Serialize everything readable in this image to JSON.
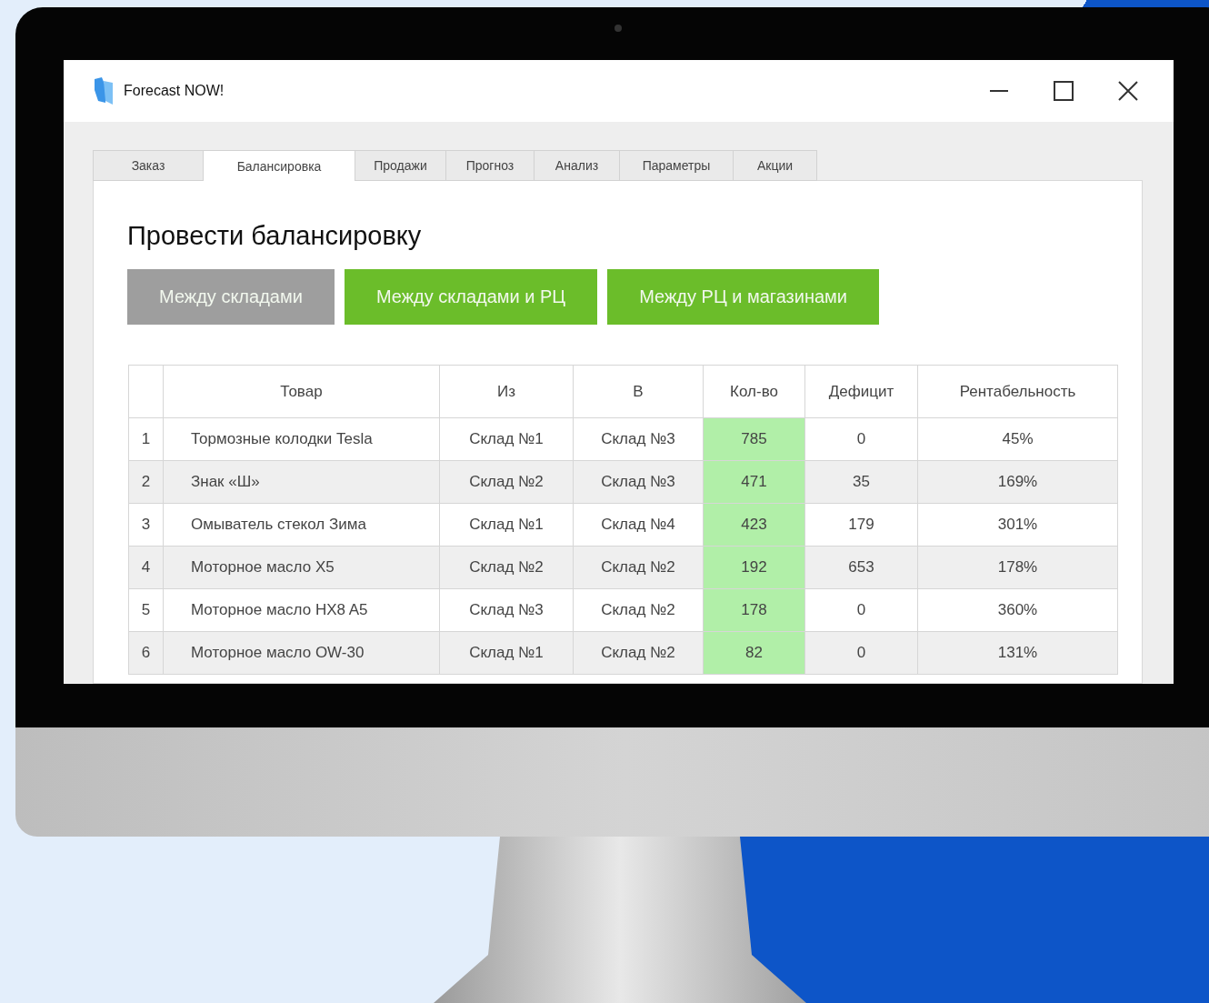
{
  "window": {
    "title": "Forecast NOW!"
  },
  "tabs": [
    {
      "label": "Заказ",
      "selected": false
    },
    {
      "label": "Балансировка",
      "selected": true
    },
    {
      "label": "Продажи",
      "selected": false
    },
    {
      "label": "Прогноз",
      "selected": false
    },
    {
      "label": "Анализ",
      "selected": false
    },
    {
      "label": "Параметры",
      "selected": false
    },
    {
      "label": "Акции",
      "selected": false
    }
  ],
  "heading": "Провести балансировку",
  "modes": [
    {
      "label": "Между складами",
      "selected": true
    },
    {
      "label": "Между складами и РЦ",
      "selected": false
    },
    {
      "label": "Между РЦ и магазинами",
      "selected": false
    }
  ],
  "table": {
    "columns": [
      {
        "label": "Товар",
        "highlighted": false
      },
      {
        "label": "Из",
        "highlighted": false
      },
      {
        "label": "В",
        "highlighted": false
      },
      {
        "label": "Кол-во",
        "highlighted": true
      },
      {
        "label": "Дефицит",
        "highlighted": false
      },
      {
        "label": "Рентабельность",
        "highlighted": false
      }
    ],
    "rows": [
      {
        "number": "1",
        "cells": [
          "Тормозные колодки Tesla",
          "Склад №1",
          "Склад №3",
          "785",
          "0",
          "45%"
        ]
      },
      {
        "number": "2",
        "cells": [
          "Знак «Ш»",
          "Склад №2",
          "Склад №3",
          "471",
          "35",
          "169%"
        ]
      },
      {
        "number": "3",
        "cells": [
          "Омыватель стекол Зима",
          "Склад №1",
          "Склад №4",
          "423",
          "179",
          "301%"
        ]
      },
      {
        "number": "4",
        "cells": [
          "Моторное масло X5",
          "Склад №2",
          "Склад №2",
          "192",
          "653",
          "178%"
        ]
      },
      {
        "number": "5",
        "cells": [
          "Моторное масло HX8 A5",
          "Склад №3",
          "Склад №2",
          "178",
          "0",
          "360%"
        ]
      },
      {
        "number": "6",
        "cells": [
          "Моторное масло OW-30",
          "Склад №1",
          "Склад №2",
          "82",
          "0",
          "131%"
        ]
      }
    ]
  }
}
